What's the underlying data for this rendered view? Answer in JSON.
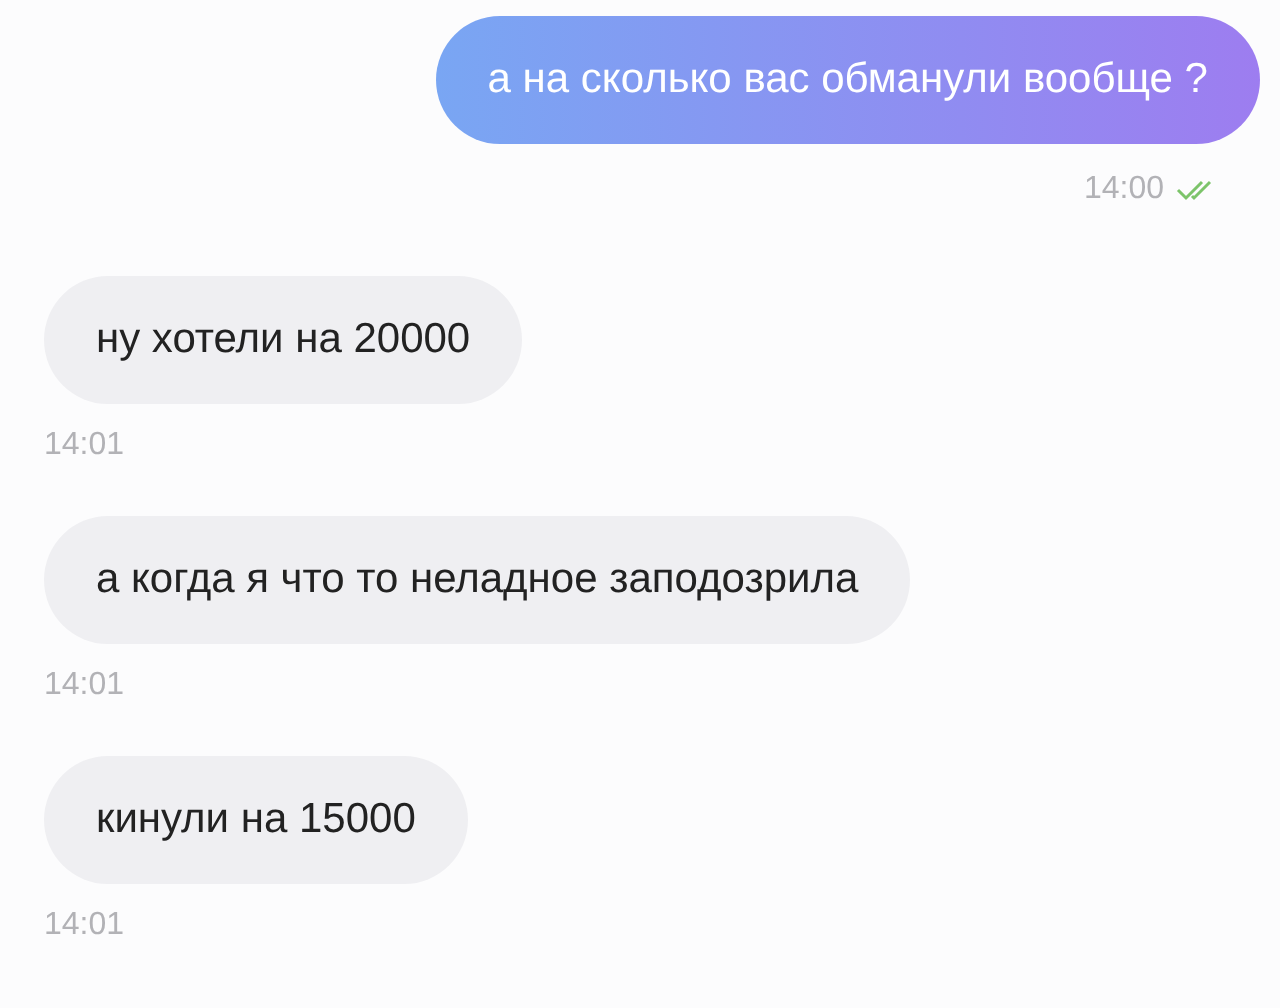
{
  "messages": [
    {
      "kind": "outgoing",
      "text": "а на сколько вас обманули вообще ?",
      "time": "14:00",
      "read": true
    },
    {
      "kind": "incoming",
      "text": "ну хотели на 20000",
      "time": "14:01"
    },
    {
      "kind": "incoming",
      "text": "а когда я что то неладное заподозрила",
      "time": "14:01"
    },
    {
      "kind": "incoming",
      "text": "кинули на 15000",
      "time": "14:01"
    }
  ]
}
